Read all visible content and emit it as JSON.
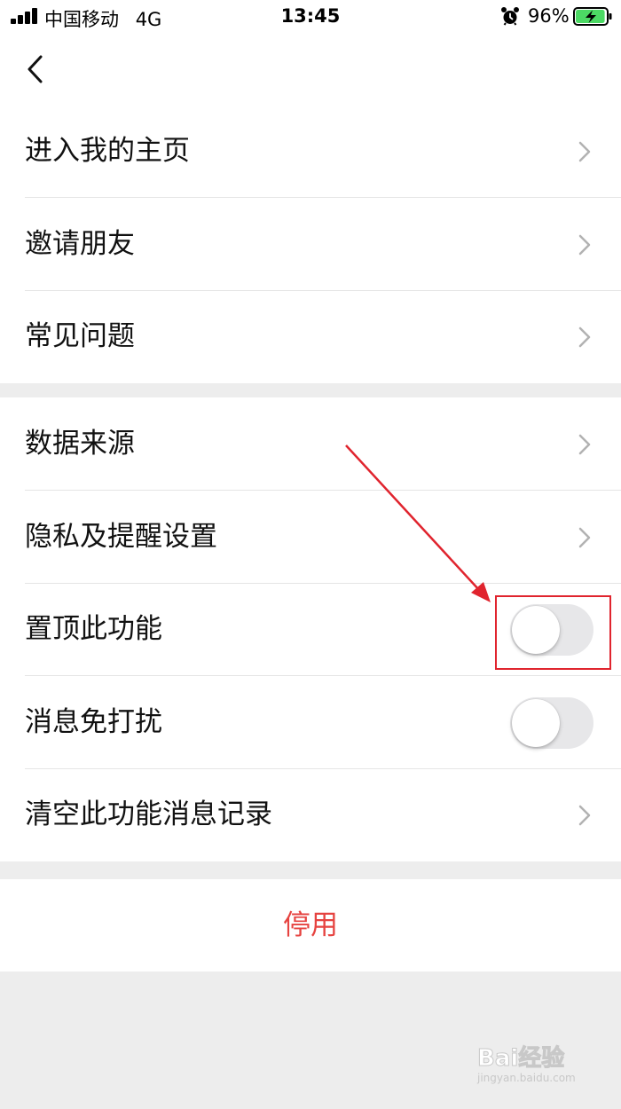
{
  "status_bar": {
    "carrier": "中国移动",
    "network": "4G",
    "time": "13:45",
    "battery_percent": "96%",
    "battery_level": 0.96,
    "battery_color": "#4cd964"
  },
  "nav": {
    "back_icon": "chevron-left-icon"
  },
  "group1": {
    "items": [
      {
        "label": "进入我的主页",
        "control": "chevron"
      },
      {
        "label": "邀请朋友",
        "control": "chevron"
      },
      {
        "label": "常见问题",
        "control": "chevron"
      }
    ]
  },
  "group2": {
    "items": [
      {
        "label": "数据来源",
        "control": "chevron"
      },
      {
        "label": "隐私及提醒设置",
        "control": "chevron"
      },
      {
        "label": "置顶此功能",
        "control": "toggle",
        "on": false
      },
      {
        "label": "消息免打扰",
        "control": "toggle",
        "on": false
      },
      {
        "label": "清空此功能消息记录",
        "control": "chevron"
      }
    ]
  },
  "disable_button": {
    "label": "停用",
    "color": "#e64340"
  },
  "annotation": {
    "color": "#e0242e"
  },
  "watermark": {
    "logo": "Bai经验",
    "url": "jingyan.baidu.com"
  }
}
